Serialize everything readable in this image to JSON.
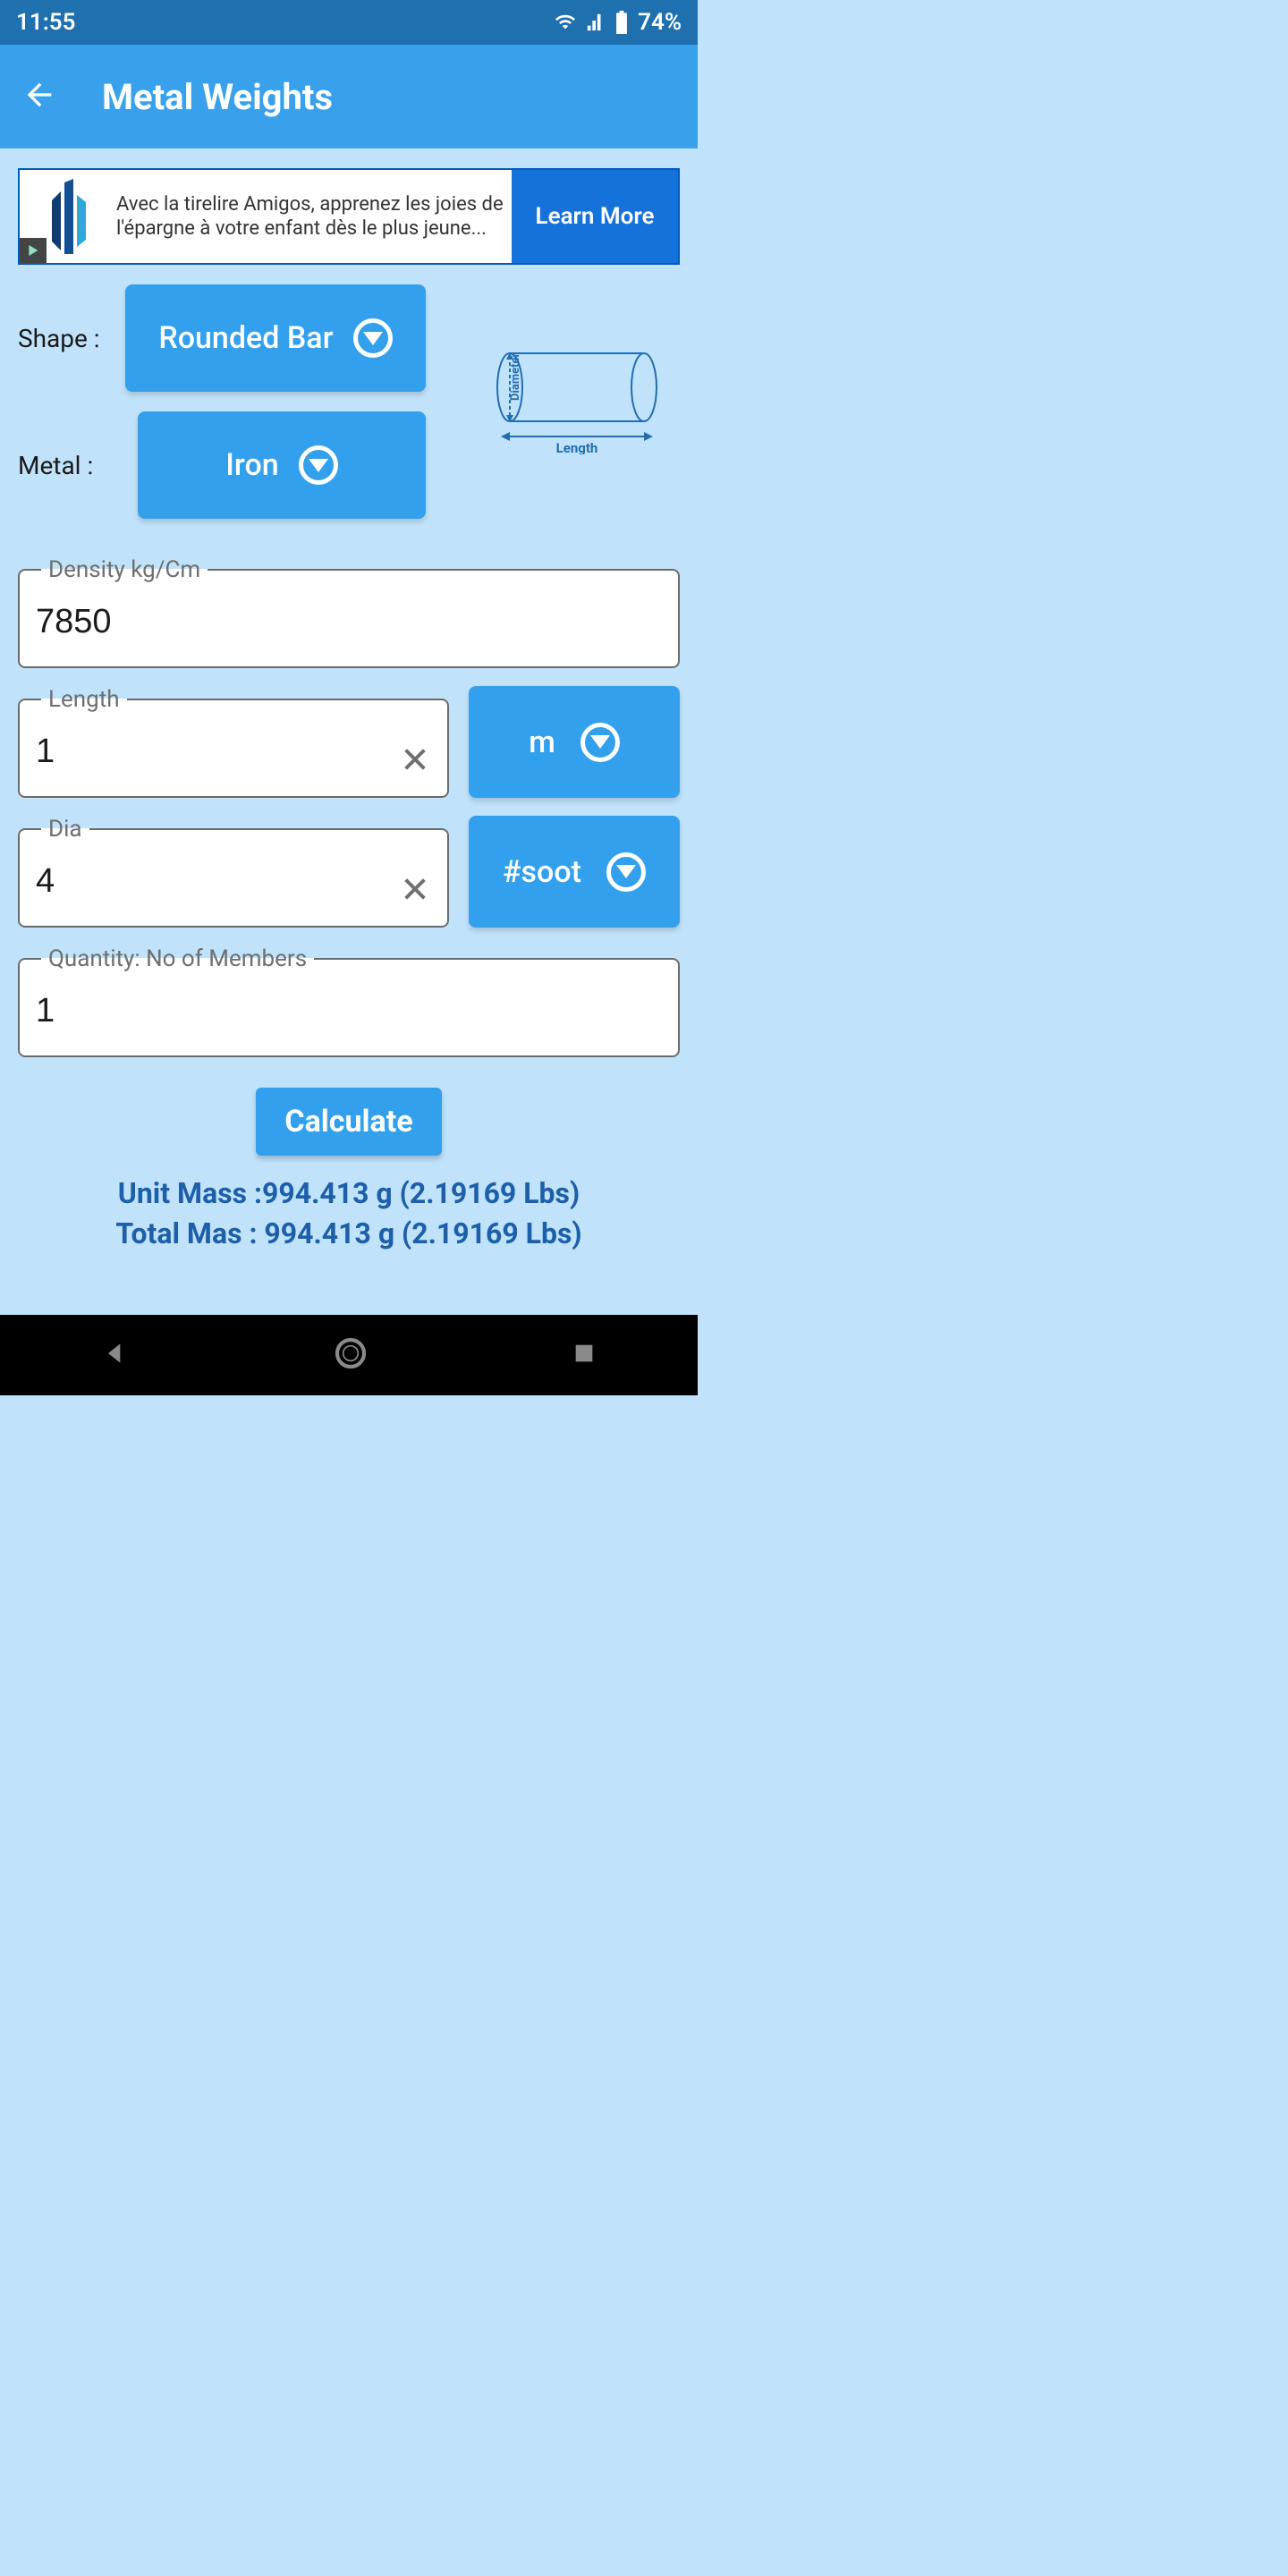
{
  "status": {
    "time": "11:55",
    "battery": "74%"
  },
  "appbar": {
    "title": "Metal Weights"
  },
  "ad": {
    "text": "Avec la tirelire Amigos, apprenez les joies de l'épargne à votre enfant dès le plus jeune...",
    "cta": "Learn More"
  },
  "form": {
    "shape_label": "Shape :",
    "shape_value": "Rounded Bar",
    "metal_label": "Metal :",
    "metal_value": "Iron",
    "diagram": {
      "diameter": "Diameter",
      "length": "Length"
    },
    "density": {
      "label": "Density kg/Cm",
      "value": "7850"
    },
    "length": {
      "label": "Length",
      "value": "1",
      "unit": "m"
    },
    "dia": {
      "label": "Dia",
      "value": "4",
      "unit": "#soot"
    },
    "quantity": {
      "label": "Quantity: No of Members",
      "value": "1"
    },
    "calculate": "Calculate"
  },
  "results": {
    "unit": "Unit Mass :994.413 g (2.19169 Lbs)",
    "total": "Total Mas : 994.413 g (2.19169 Lbs)"
  }
}
